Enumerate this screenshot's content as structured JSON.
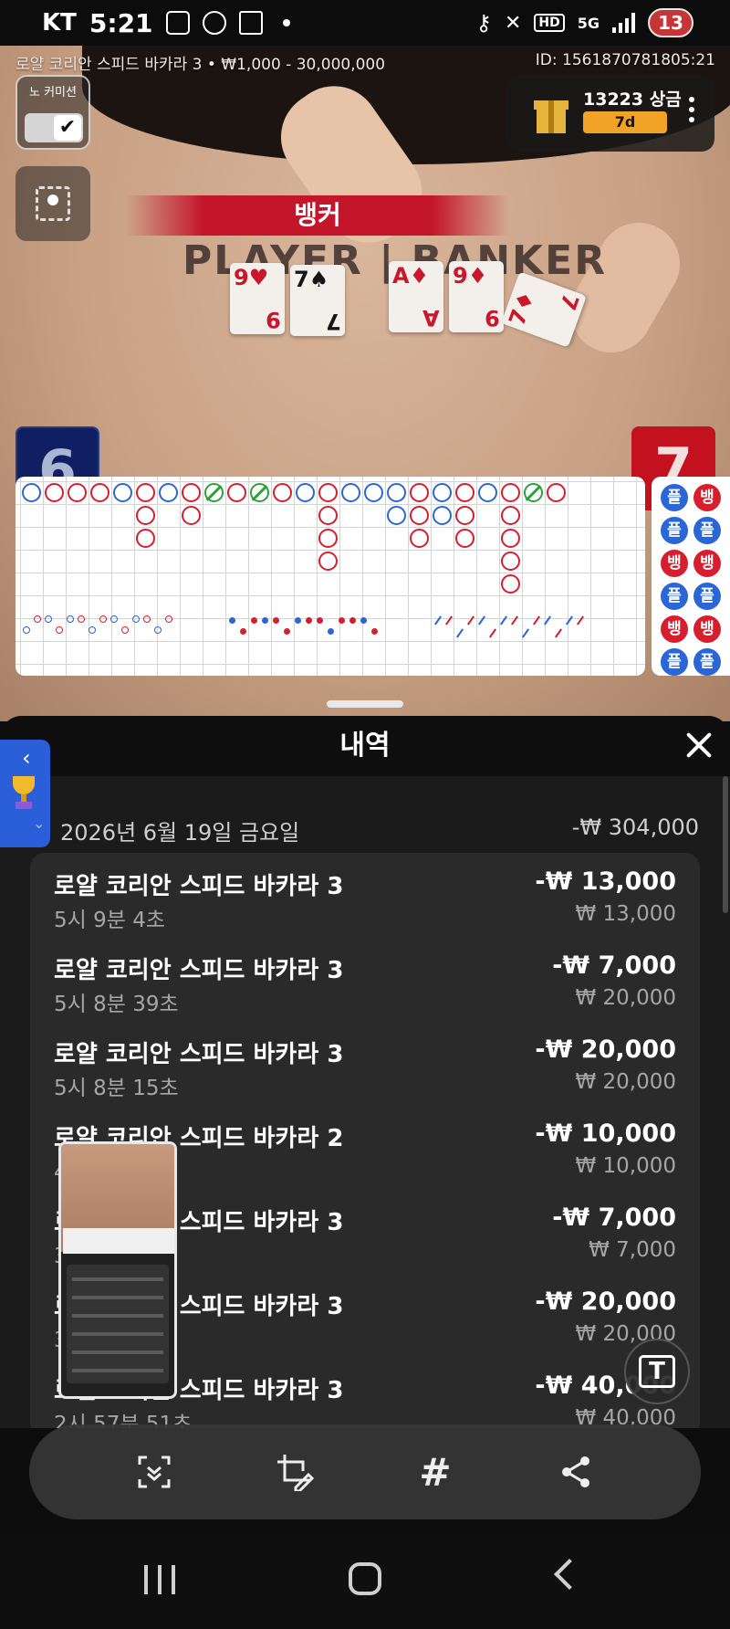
{
  "status_bar": {
    "carrier": "KT",
    "time": "5:21",
    "network": "5G",
    "hd_label": "HD",
    "battery": "13"
  },
  "game": {
    "table_info": "로얄 코리안 스피드 바카라 3 • ₩1,000 - 30,000,000",
    "round_id": "ID: 1561870781805:21",
    "no_commission_label": "노 커미션",
    "no_commission_checked": "✔",
    "prize_text": "13223 상금",
    "prize_days": "7d",
    "result_banner": "뱅커",
    "table_print": "PLAYER | BANKER",
    "player_cards": [
      {
        "rank": "9",
        "suit": "♥",
        "color": "red"
      },
      {
        "rank": "7",
        "suit": "♠",
        "color": "black"
      }
    ],
    "banker_cards": [
      {
        "rank": "A",
        "suit": "♦",
        "color": "red"
      },
      {
        "rank": "9",
        "suit": "♦",
        "color": "red"
      },
      {
        "rank": "7",
        "suit": "♦",
        "color": "red"
      }
    ],
    "player_score": "6",
    "banker_score": "7",
    "predictions": [
      [
        "플",
        "뱅"
      ],
      [
        "플",
        "플"
      ],
      [
        "뱅",
        "뱅"
      ],
      [
        "플",
        "플"
      ],
      [
        "뱅",
        "뱅"
      ],
      [
        "플",
        "플"
      ]
    ]
  },
  "roadmap": {
    "colors": {
      "banker": "#d61e2e",
      "player": "#2a66d6",
      "tie": "#2aa13a"
    },
    "big_road_row1": [
      "P",
      "B",
      "B",
      "B",
      "P",
      "B",
      "P",
      "B",
      "T",
      "B",
      "T",
      "B",
      "P",
      "B",
      "P",
      "P",
      "P",
      "B",
      "P",
      "B",
      "P",
      "B",
      "T",
      "B"
    ],
    "big_road_extra": [
      {
        "col": 5,
        "row": 1,
        "r": "B"
      },
      {
        "col": 5,
        "row": 2,
        "r": "B"
      },
      {
        "col": 7,
        "row": 1,
        "r": "B"
      },
      {
        "col": 13,
        "row": 1,
        "r": "B"
      },
      {
        "col": 13,
        "row": 2,
        "r": "B"
      },
      {
        "col": 13,
        "row": 3,
        "r": "B"
      },
      {
        "col": 16,
        "row": 1,
        "r": "P"
      },
      {
        "col": 17,
        "row": 1,
        "r": "B"
      },
      {
        "col": 17,
        "row": 2,
        "r": "B"
      },
      {
        "col": 18,
        "row": 1,
        "r": "P"
      },
      {
        "col": 19,
        "row": 1,
        "r": "B"
      },
      {
        "col": 19,
        "row": 2,
        "r": "B"
      },
      {
        "col": 21,
        "row": 1,
        "r": "B"
      },
      {
        "col": 21,
        "row": 2,
        "r": "B"
      },
      {
        "col": 21,
        "row": 3,
        "r": "B"
      },
      {
        "col": 21,
        "row": 4,
        "r": "B"
      }
    ]
  },
  "history": {
    "title": "내역",
    "date": "2026년 6월 19일 금요일",
    "date_total": "-₩ 304,000",
    "rows": [
      {
        "name": "로얄 코리안 스피드 바카라 3",
        "time": "5시 9분 4초",
        "amount": "-₩ 13,000",
        "stake": "₩ 13,000"
      },
      {
        "name": "로얄 코리안 스피드 바카라 3",
        "time": "5시 8분 39초",
        "amount": "-₩ 7,000",
        "stake": "₩ 20,000"
      },
      {
        "name": "로얄 코리안 스피드 바카라 3",
        "time": "5시 8분 15초",
        "amount": "-₩ 20,000",
        "stake": "₩ 20,000"
      },
      {
        "name": "로얄 코리안 스피드 바카라 2",
        "time": "4시 5분 5초",
        "amount": "-₩ 10,000",
        "stake": "₩ 10,000"
      },
      {
        "name": "로얄 코리안 스피드 바카라 3",
        "time": "3시 4분 1초",
        "amount": "-₩ 7,000",
        "stake": "₩ 7,000"
      },
      {
        "name": "로얄 코리안 스피드 바카라 3",
        "time": "3시 0분 2초",
        "amount": "-₩ 20,000",
        "stake": "₩ 20,000"
      },
      {
        "name": "로얄 코리안 스피드 바카라 3",
        "time": "2시 57분 51초",
        "amount": "-₩ 40,000",
        "stake": "₩ 40,000"
      }
    ]
  },
  "side_tab": {
    "chevron_up": "‹",
    "chevron_down": "⌄"
  },
  "toolbar": {
    "tools": [
      "scroll-capture-icon",
      "crop-edit-icon",
      "hashtag-icon",
      "share-icon"
    ],
    "hashtag_glyph": "#",
    "text_fab_glyph": "T"
  }
}
